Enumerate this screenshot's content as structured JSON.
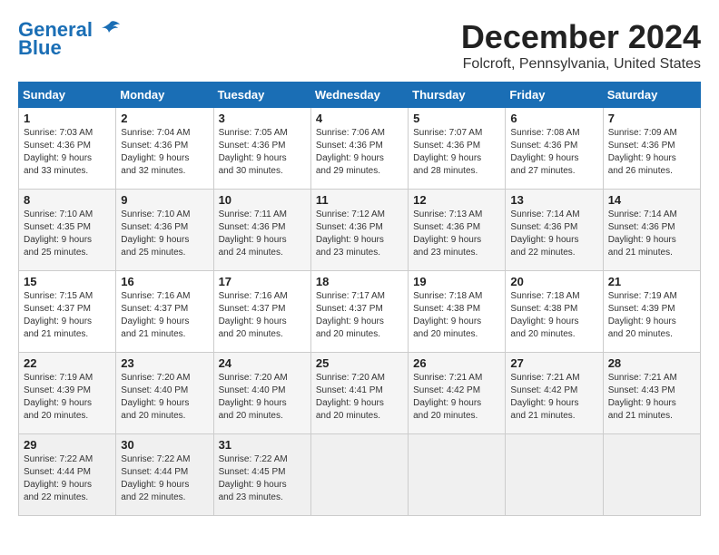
{
  "logo": {
    "line1": "General",
    "line2": "Blue"
  },
  "title": "December 2024",
  "subtitle": "Folcroft, Pennsylvania, United States",
  "days_of_week": [
    "Sunday",
    "Monday",
    "Tuesday",
    "Wednesday",
    "Thursday",
    "Friday",
    "Saturday"
  ],
  "weeks": [
    [
      {
        "day": 1,
        "info": "Sunrise: 7:03 AM\nSunset: 4:36 PM\nDaylight: 9 hours\nand 33 minutes."
      },
      {
        "day": 2,
        "info": "Sunrise: 7:04 AM\nSunset: 4:36 PM\nDaylight: 9 hours\nand 32 minutes."
      },
      {
        "day": 3,
        "info": "Sunrise: 7:05 AM\nSunset: 4:36 PM\nDaylight: 9 hours\nand 30 minutes."
      },
      {
        "day": 4,
        "info": "Sunrise: 7:06 AM\nSunset: 4:36 PM\nDaylight: 9 hours\nand 29 minutes."
      },
      {
        "day": 5,
        "info": "Sunrise: 7:07 AM\nSunset: 4:36 PM\nDaylight: 9 hours\nand 28 minutes."
      },
      {
        "day": 6,
        "info": "Sunrise: 7:08 AM\nSunset: 4:36 PM\nDaylight: 9 hours\nand 27 minutes."
      },
      {
        "day": 7,
        "info": "Sunrise: 7:09 AM\nSunset: 4:36 PM\nDaylight: 9 hours\nand 26 minutes."
      }
    ],
    [
      {
        "day": 8,
        "info": "Sunrise: 7:10 AM\nSunset: 4:35 PM\nDaylight: 9 hours\nand 25 minutes."
      },
      {
        "day": 9,
        "info": "Sunrise: 7:10 AM\nSunset: 4:36 PM\nDaylight: 9 hours\nand 25 minutes."
      },
      {
        "day": 10,
        "info": "Sunrise: 7:11 AM\nSunset: 4:36 PM\nDaylight: 9 hours\nand 24 minutes."
      },
      {
        "day": 11,
        "info": "Sunrise: 7:12 AM\nSunset: 4:36 PM\nDaylight: 9 hours\nand 23 minutes."
      },
      {
        "day": 12,
        "info": "Sunrise: 7:13 AM\nSunset: 4:36 PM\nDaylight: 9 hours\nand 23 minutes."
      },
      {
        "day": 13,
        "info": "Sunrise: 7:14 AM\nSunset: 4:36 PM\nDaylight: 9 hours\nand 22 minutes."
      },
      {
        "day": 14,
        "info": "Sunrise: 7:14 AM\nSunset: 4:36 PM\nDaylight: 9 hours\nand 21 minutes."
      }
    ],
    [
      {
        "day": 15,
        "info": "Sunrise: 7:15 AM\nSunset: 4:37 PM\nDaylight: 9 hours\nand 21 minutes."
      },
      {
        "day": 16,
        "info": "Sunrise: 7:16 AM\nSunset: 4:37 PM\nDaylight: 9 hours\nand 21 minutes."
      },
      {
        "day": 17,
        "info": "Sunrise: 7:16 AM\nSunset: 4:37 PM\nDaylight: 9 hours\nand 20 minutes."
      },
      {
        "day": 18,
        "info": "Sunrise: 7:17 AM\nSunset: 4:37 PM\nDaylight: 9 hours\nand 20 minutes."
      },
      {
        "day": 19,
        "info": "Sunrise: 7:18 AM\nSunset: 4:38 PM\nDaylight: 9 hours\nand 20 minutes."
      },
      {
        "day": 20,
        "info": "Sunrise: 7:18 AM\nSunset: 4:38 PM\nDaylight: 9 hours\nand 20 minutes."
      },
      {
        "day": 21,
        "info": "Sunrise: 7:19 AM\nSunset: 4:39 PM\nDaylight: 9 hours\nand 20 minutes."
      }
    ],
    [
      {
        "day": 22,
        "info": "Sunrise: 7:19 AM\nSunset: 4:39 PM\nDaylight: 9 hours\nand 20 minutes."
      },
      {
        "day": 23,
        "info": "Sunrise: 7:20 AM\nSunset: 4:40 PM\nDaylight: 9 hours\nand 20 minutes."
      },
      {
        "day": 24,
        "info": "Sunrise: 7:20 AM\nSunset: 4:40 PM\nDaylight: 9 hours\nand 20 minutes."
      },
      {
        "day": 25,
        "info": "Sunrise: 7:20 AM\nSunset: 4:41 PM\nDaylight: 9 hours\nand 20 minutes."
      },
      {
        "day": 26,
        "info": "Sunrise: 7:21 AM\nSunset: 4:42 PM\nDaylight: 9 hours\nand 20 minutes."
      },
      {
        "day": 27,
        "info": "Sunrise: 7:21 AM\nSunset: 4:42 PM\nDaylight: 9 hours\nand 21 minutes."
      },
      {
        "day": 28,
        "info": "Sunrise: 7:21 AM\nSunset: 4:43 PM\nDaylight: 9 hours\nand 21 minutes."
      }
    ],
    [
      {
        "day": 29,
        "info": "Sunrise: 7:22 AM\nSunset: 4:44 PM\nDaylight: 9 hours\nand 22 minutes."
      },
      {
        "day": 30,
        "info": "Sunrise: 7:22 AM\nSunset: 4:44 PM\nDaylight: 9 hours\nand 22 minutes."
      },
      {
        "day": 31,
        "info": "Sunrise: 7:22 AM\nSunset: 4:45 PM\nDaylight: 9 hours\nand 23 minutes."
      },
      null,
      null,
      null,
      null
    ]
  ]
}
